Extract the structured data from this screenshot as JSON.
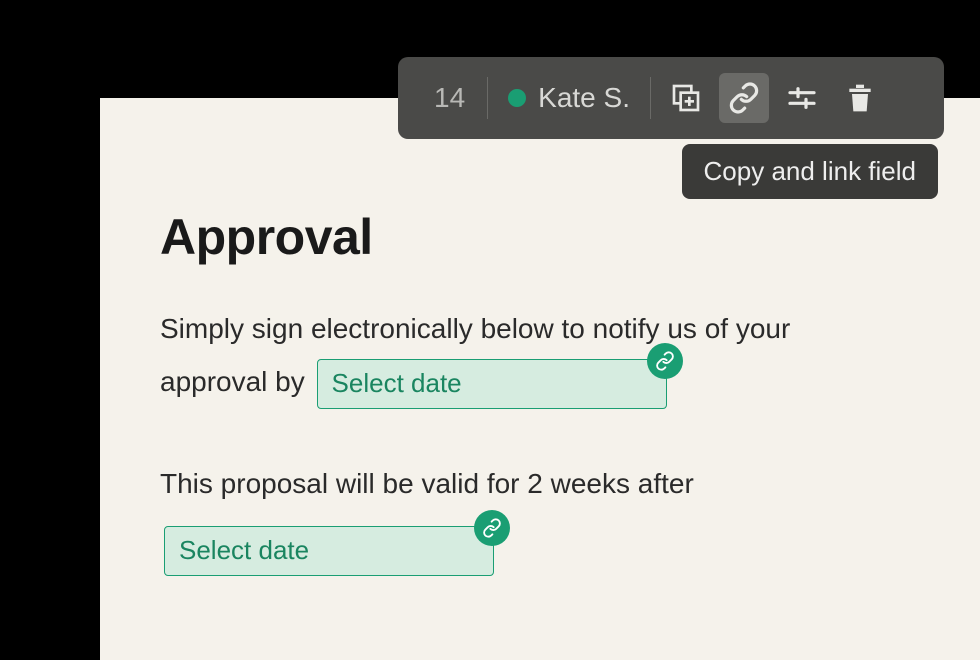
{
  "toolbar": {
    "number": "14",
    "user_name": "Kate S."
  },
  "tooltip": {
    "text": "Copy and link field"
  },
  "document": {
    "heading": "Approval",
    "paragraph1_part1": "Simply sign electronically below to notify us of your",
    "paragraph1_part2": "approval by",
    "date_field_1": "Select date",
    "paragraph2": "This proposal will be valid for 2 weeks after",
    "date_field_2": "Select date"
  }
}
